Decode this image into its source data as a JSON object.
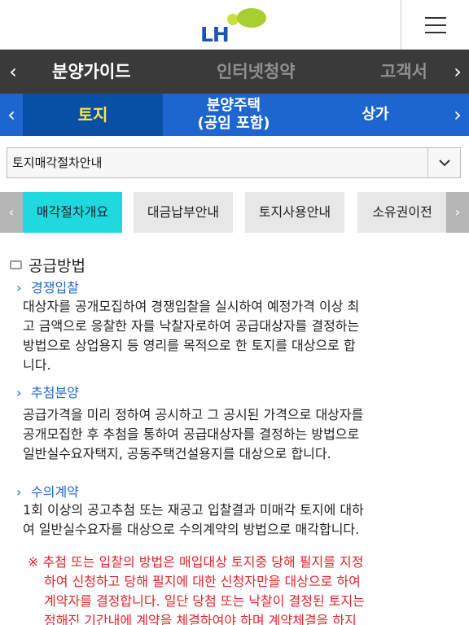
{
  "header": {
    "logo_text": "LH",
    "brand_colors": {
      "blue": "#1a57b5",
      "green": "#a6cf2f"
    }
  },
  "nav_primary": {
    "items": [
      {
        "label": "분양가이드",
        "active": true
      },
      {
        "label": "인터넷청약",
        "active": false
      },
      {
        "label": "고객서",
        "active": false
      }
    ],
    "left_arrow": "‹",
    "right_arrow": "›"
  },
  "nav_secondary": {
    "items": [
      {
        "label": "토지",
        "active": true
      },
      {
        "label_line1": "분양주택",
        "label_line2": "(공임 포함)",
        "active": false
      },
      {
        "label": "상가",
        "active": false
      }
    ],
    "left_arrow": "‹",
    "right_arrow": "›"
  },
  "select": {
    "value": "토지매각절차안내",
    "dropdown_icon": "chevron-down-icon"
  },
  "subtabs": {
    "items": [
      {
        "label": "매각절차개요",
        "active": true
      },
      {
        "label": "대금납부안내",
        "active": false
      },
      {
        "label": "토지사용안내",
        "active": false
      },
      {
        "label": "소유권이전",
        "active": false
      }
    ],
    "left_arrow": "‹",
    "right_arrow": "›"
  },
  "content": {
    "section_title": "공급방법",
    "sections": [
      {
        "title": "경쟁입찰",
        "lines": [
          "대상자를 공개모집하여 경쟁입찰을 실시하여 예정가격 이상  최",
          "고 금액으로 응찰한 자를 낙찰자로하여 공급대상자를 결정하는",
          "방법으로 상업용지 등 영리를 목적으로 한 토지를 대상으로 합",
          "니다."
        ]
      },
      {
        "title": "추첨분양",
        "lines": [
          "공급가격을 미리 정하여 공시하고 그 공시된 가격으로 대상자를",
          "공개모집한 후 추첨을 통하여 공급대상자를 결정하는 방법으로",
          "일반실수요자택지, 공동주택건설용지를 대상으로 합니다."
        ]
      },
      {
        "title": "수의계약",
        "lines": [
          "1회 이상의 공고추첨 또는 재공고 입찰결과 미매각 토지에 대하",
          "여 일반실수요자를 대상으로 수의계약의 방법으로 매각합니다."
        ]
      }
    ],
    "note_lines": [
      "※ 추첨 또는 입찰의 방법은 매입대상 토지중 당해 필지를 지정",
      "하여 신청하고 당해 필지에 대한 신청자만을 대상으로 하여",
      "계약자를 결정합니다. 일단 당첨 또는 낙찰이 결정된 토지는",
      "정해진 기간내에 계약을 체결하여야 하며 계약체결을 하지"
    ],
    "colors": {
      "link_blue": "#1e66cf",
      "note_red": "#e4232b"
    }
  }
}
